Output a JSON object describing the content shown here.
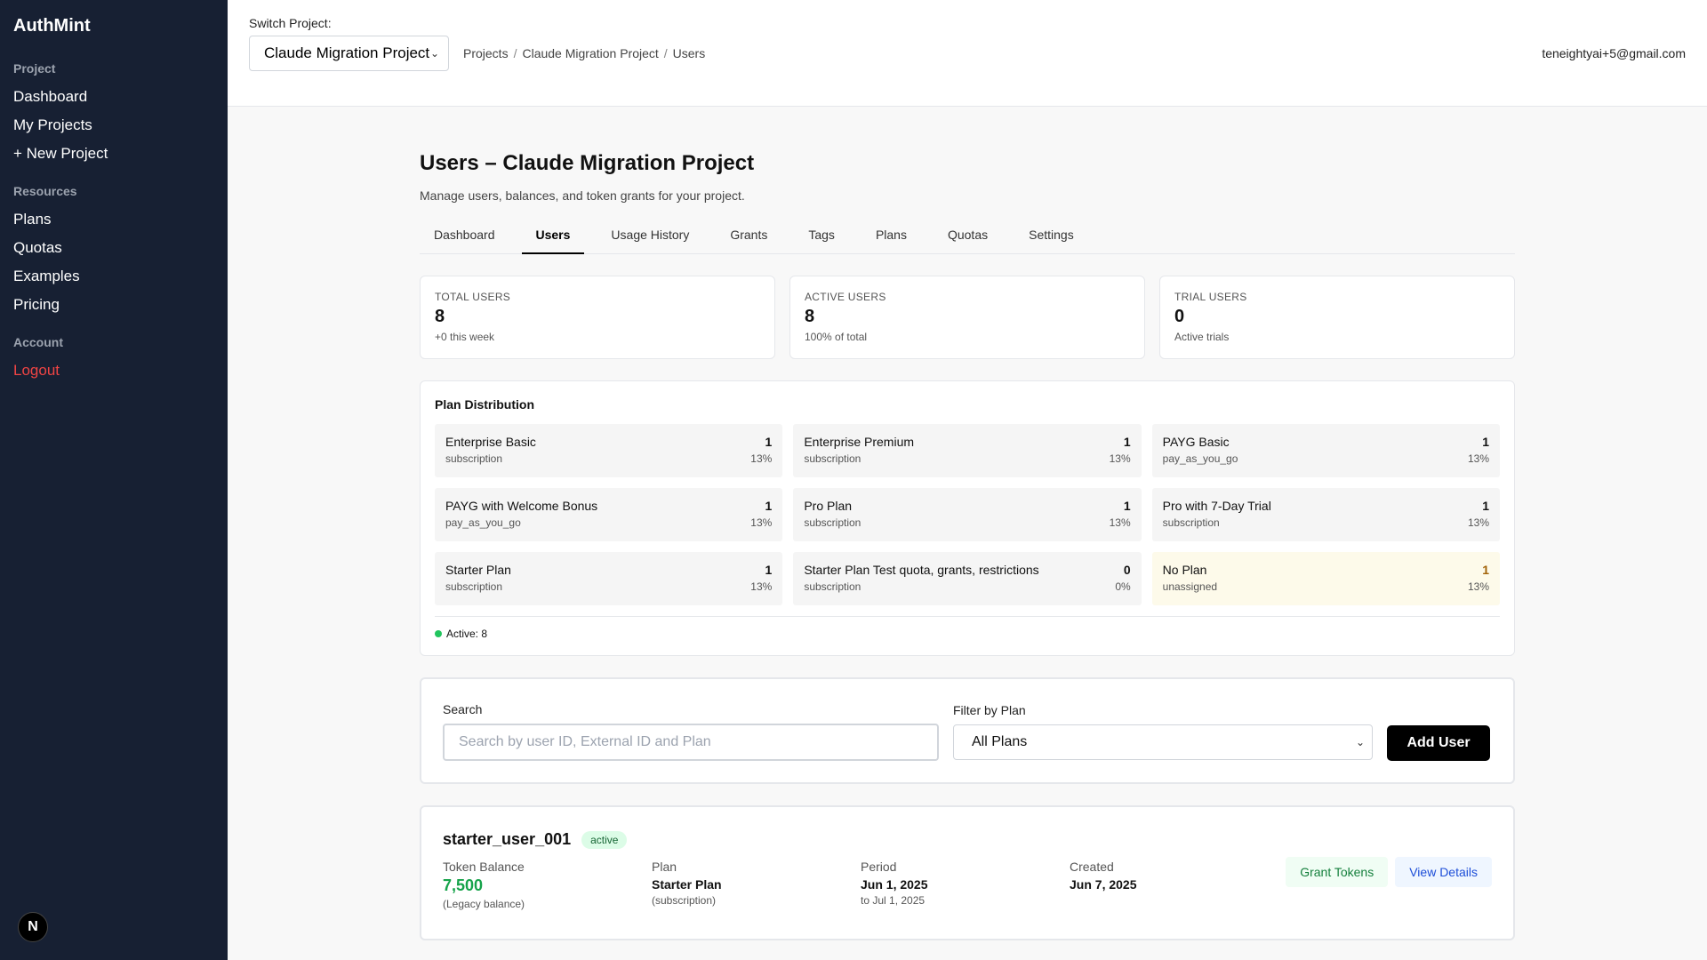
{
  "sidebar": {
    "brand": "AuthMint",
    "sections": {
      "project": {
        "title": "Project",
        "items": [
          "Dashboard",
          "My Projects",
          "+ New Project"
        ]
      },
      "resources": {
        "title": "Resources",
        "items": [
          "Plans",
          "Quotas",
          "Examples",
          "Pricing"
        ]
      },
      "account": {
        "title": "Account",
        "items": [
          "Logout"
        ]
      }
    },
    "badge": "N"
  },
  "topbar": {
    "switch_label": "Switch Project:",
    "selected_project": "Claude Migration Project",
    "breadcrumb": [
      "Projects",
      "/",
      "Claude Migration Project",
      "/",
      "Users"
    ],
    "user_email": "teneightyai+5@gmail.com"
  },
  "page": {
    "title": "Users – Claude Migration Project",
    "subtitle": "Manage users, balances, and token grants for your project."
  },
  "tabs": [
    "Dashboard",
    "Users",
    "Usage History",
    "Grants",
    "Tags",
    "Plans",
    "Quotas",
    "Settings"
  ],
  "stats": [
    {
      "label": "TOTAL USERS",
      "value": "8",
      "note": "+0 this week"
    },
    {
      "label": "ACTIVE USERS",
      "value": "8",
      "note": "100% of total"
    },
    {
      "label": "TRIAL USERS",
      "value": "0",
      "note": "Active trials"
    }
  ],
  "plan_distribution": {
    "title": "Plan Distribution",
    "plans": [
      {
        "name": "Enterprise Basic",
        "type": "subscription",
        "count": "1",
        "pct": "13%"
      },
      {
        "name": "Enterprise Premium",
        "type": "subscription",
        "count": "1",
        "pct": "13%"
      },
      {
        "name": "PAYG Basic",
        "type": "pay_as_you_go",
        "count": "1",
        "pct": "13%"
      },
      {
        "name": "PAYG with Welcome Bonus",
        "type": "pay_as_you_go",
        "count": "1",
        "pct": "13%"
      },
      {
        "name": "Pro Plan",
        "type": "subscription",
        "count": "1",
        "pct": "13%"
      },
      {
        "name": "Pro with 7-Day Trial",
        "type": "subscription",
        "count": "1",
        "pct": "13%"
      },
      {
        "name": "Starter Plan",
        "type": "subscription",
        "count": "1",
        "pct": "13%"
      },
      {
        "name": "Starter Plan Test quota, grants, restrictions",
        "type": "subscription",
        "count": "0",
        "pct": "0%"
      },
      {
        "name": "No Plan",
        "type": "unassigned",
        "count": "1",
        "pct": "13%"
      }
    ],
    "footer": "Active: 8"
  },
  "filters": {
    "search_label": "Search",
    "search_placeholder": "Search by user ID, External ID and Plan",
    "plan_label": "Filter by Plan",
    "plan_selected": "All Plans",
    "add_button": "Add User"
  },
  "user": {
    "id": "starter_user_001",
    "status": "active",
    "token_label": "Token Balance",
    "token_value": "7,500",
    "token_note": "(Legacy balance)",
    "plan_label": "Plan",
    "plan_value": "Starter Plan",
    "plan_note": "(subscription)",
    "period_label": "Period",
    "period_value": "Jun 1, 2025",
    "period_note": "to Jul 1, 2025",
    "created_label": "Created",
    "created_value": "Jun 7, 2025",
    "grant_button": "Grant Tokens",
    "view_button": "View Details"
  }
}
